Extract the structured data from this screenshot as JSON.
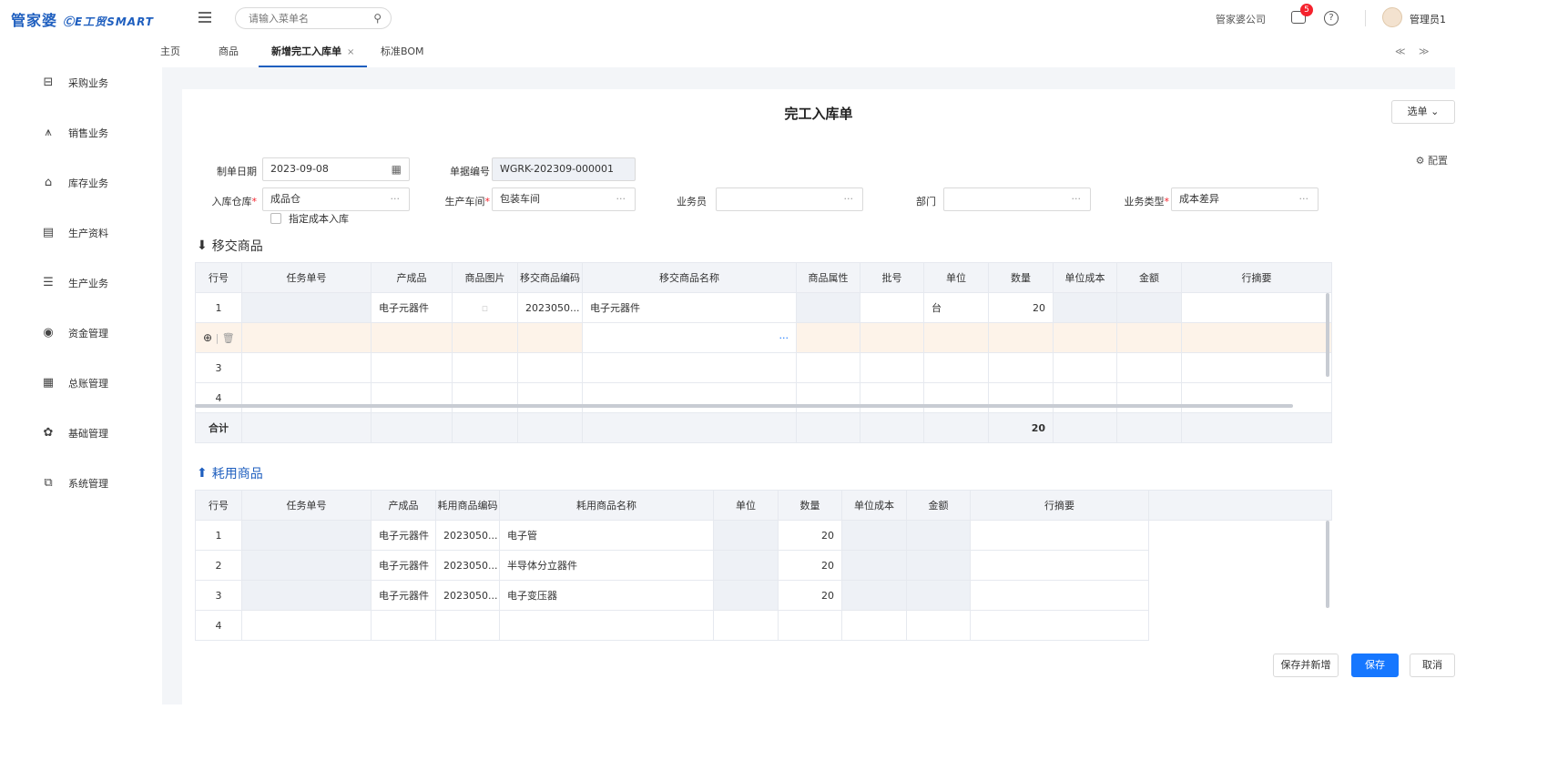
{
  "app": {
    "logo_cn": "管家婆",
    "logo_en": "ⒸE工贸SMART"
  },
  "header": {
    "search_placeholder": "请输入菜单名",
    "company": "管家婆公司",
    "message_badge": "5",
    "user": "管理员1"
  },
  "sidebar": {
    "items": [
      {
        "label": "采购业务",
        "icon": "purchase-icon"
      },
      {
        "label": "销售业务",
        "icon": "sales-icon"
      },
      {
        "label": "库存业务",
        "icon": "inventory-icon"
      },
      {
        "label": "生产资料",
        "icon": "production-data-icon"
      },
      {
        "label": "生产业务",
        "icon": "production-icon"
      },
      {
        "label": "资金管理",
        "icon": "funds-icon"
      },
      {
        "label": "总账管理",
        "icon": "ledger-icon"
      },
      {
        "label": "基础管理",
        "icon": "basic-icon"
      },
      {
        "label": "系统管理",
        "icon": "system-icon"
      }
    ]
  },
  "tabs": [
    {
      "label": "主页"
    },
    {
      "label": "商品"
    },
    {
      "label": "新增完工入库单",
      "close": "×"
    },
    {
      "label": "标准BOM"
    }
  ],
  "tab_nav": {
    "prev": "≪",
    "next": "≫"
  },
  "doc": {
    "title": "完工入库单",
    "select_button": "选单 ⌄",
    "config": "配置",
    "fields": {
      "date_label": "制单日期",
      "date_value": "2023-09-08",
      "no_label": "单据编号",
      "no_value": "WGRK-202309-000001",
      "warehouse_label": "入库仓库",
      "warehouse_value": "成品仓",
      "workshop_label": "生产车间",
      "workshop_value": "包装车间",
      "clerk_label": "业务员",
      "clerk_value": "",
      "dept_label": "部门",
      "dept_value": "",
      "biztype_label": "业务类型",
      "biztype_value": "成本差异",
      "cost_checkbox_label": "指定成本入库"
    }
  },
  "transfer": {
    "title": "移交商品",
    "headers": [
      "行号",
      "任务单号",
      "产成品",
      "商品图片",
      "移交商品编码",
      "移交商品名称",
      "商品属性",
      "批号",
      "单位",
      "数量",
      "单位成本",
      "金额",
      "行摘要"
    ],
    "rows": [
      {
        "no": "1",
        "task": "",
        "product": "电子元器件",
        "code": "2023050...",
        "name": "电子元器件",
        "attr": "",
        "batch": "",
        "unit": "台",
        "qty": "20",
        "cost": "",
        "amount": "",
        "memo": ""
      },
      {
        "no": "",
        "task": "",
        "product": "",
        "code": "",
        "name": "",
        "attr": "",
        "batch": "",
        "unit": "",
        "qty": "",
        "cost": "",
        "amount": "",
        "memo": ""
      },
      {
        "no": "3",
        "task": "",
        "product": "",
        "code": "",
        "name": "",
        "attr": "",
        "batch": "",
        "unit": "",
        "qty": "",
        "cost": "",
        "amount": "",
        "memo": ""
      },
      {
        "no": "4",
        "task": "",
        "product": "",
        "code": "",
        "name": "",
        "attr": "",
        "batch": "",
        "unit": "",
        "qty": "",
        "cost": "",
        "amount": "",
        "memo": ""
      }
    ],
    "total_label": "合计",
    "total_qty": "20"
  },
  "consume": {
    "title": "耗用商品",
    "headers": [
      "行号",
      "任务单号",
      "产成品",
      "耗用商品编码",
      "耗用商品名称",
      "单位",
      "数量",
      "单位成本",
      "金额",
      "行摘要"
    ],
    "rows": [
      {
        "no": "1",
        "product": "电子元器件",
        "code": "2023050...",
        "name": "电子管",
        "qty": "20"
      },
      {
        "no": "2",
        "product": "电子元器件",
        "code": "2023050...",
        "name": "半导体分立器件",
        "qty": "20"
      },
      {
        "no": "3",
        "product": "电子元器件",
        "code": "2023050...",
        "name": "电子变压器",
        "qty": "20"
      },
      {
        "no": "4",
        "product": "",
        "code": "",
        "name": "",
        "qty": ""
      }
    ]
  },
  "buttons": {
    "save_new": "保存并新增",
    "save": "保存",
    "cancel": "取消"
  },
  "colors": {
    "primary": "#1677ff",
    "brand": "#1f5fbf",
    "badge": "#f5222d"
  }
}
